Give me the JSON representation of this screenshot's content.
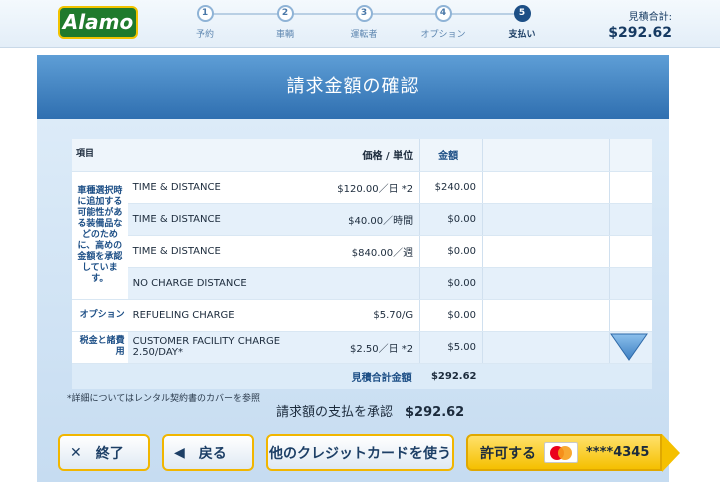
{
  "header": {
    "logo_text": "Alamo",
    "steps": [
      {
        "num": "1",
        "label": "予約"
      },
      {
        "num": "2",
        "label": "車輌"
      },
      {
        "num": "3",
        "label": "運転者"
      },
      {
        "num": "4",
        "label": "オプション"
      },
      {
        "num": "5",
        "label": "支払い"
      }
    ],
    "active_step": 5,
    "estimate_label": "見積合計:",
    "estimate_value": "$292.62"
  },
  "title": "請求金額の確認",
  "table": {
    "headers": {
      "item": "項目",
      "price": "価格 / 単位",
      "amount": "金額"
    },
    "category_vehicle": "車種選択時に追加する可能性がある装備品などのために、高めの金額を承認しています。",
    "rows": [
      {
        "desc": "TIME & DISTANCE",
        "price": "$120.00／日 *2",
        "amount": "$240.00"
      },
      {
        "desc": "TIME & DISTANCE",
        "price": "$40.00／時間",
        "amount": "$0.00"
      },
      {
        "desc": "TIME & DISTANCE",
        "price": "$840.00／週",
        "amount": "$0.00"
      },
      {
        "desc": "NO CHARGE DISTANCE",
        "price": "",
        "amount": "$0.00"
      },
      {
        "category": "オプション",
        "desc": "REFUELING CHARGE",
        "price": "$5.70/G",
        "amount": "$0.00"
      },
      {
        "category": "税金と諸費用",
        "desc": "CUSTOMER FACILITY CHARGE 2.50/DAY*",
        "price": "$2.50／日 *2",
        "amount": "$5.00"
      }
    ],
    "total_label": "見積合計金額",
    "total_value": "$292.62"
  },
  "footnote": "*詳細についてはレンタル契約書のカバーを参照",
  "approve": {
    "label": "請求額の支払を承認",
    "value": "$292.62"
  },
  "buttons": {
    "exit": "終了",
    "back": "戻る",
    "other_card": "他のクレジットカードを使う",
    "pay": "許可する",
    "card_number": "****4345"
  },
  "colors": {
    "brand_green": "#1f7a2c",
    "accent_yellow": "#f5c000",
    "primary_blue": "#1d4f86"
  }
}
